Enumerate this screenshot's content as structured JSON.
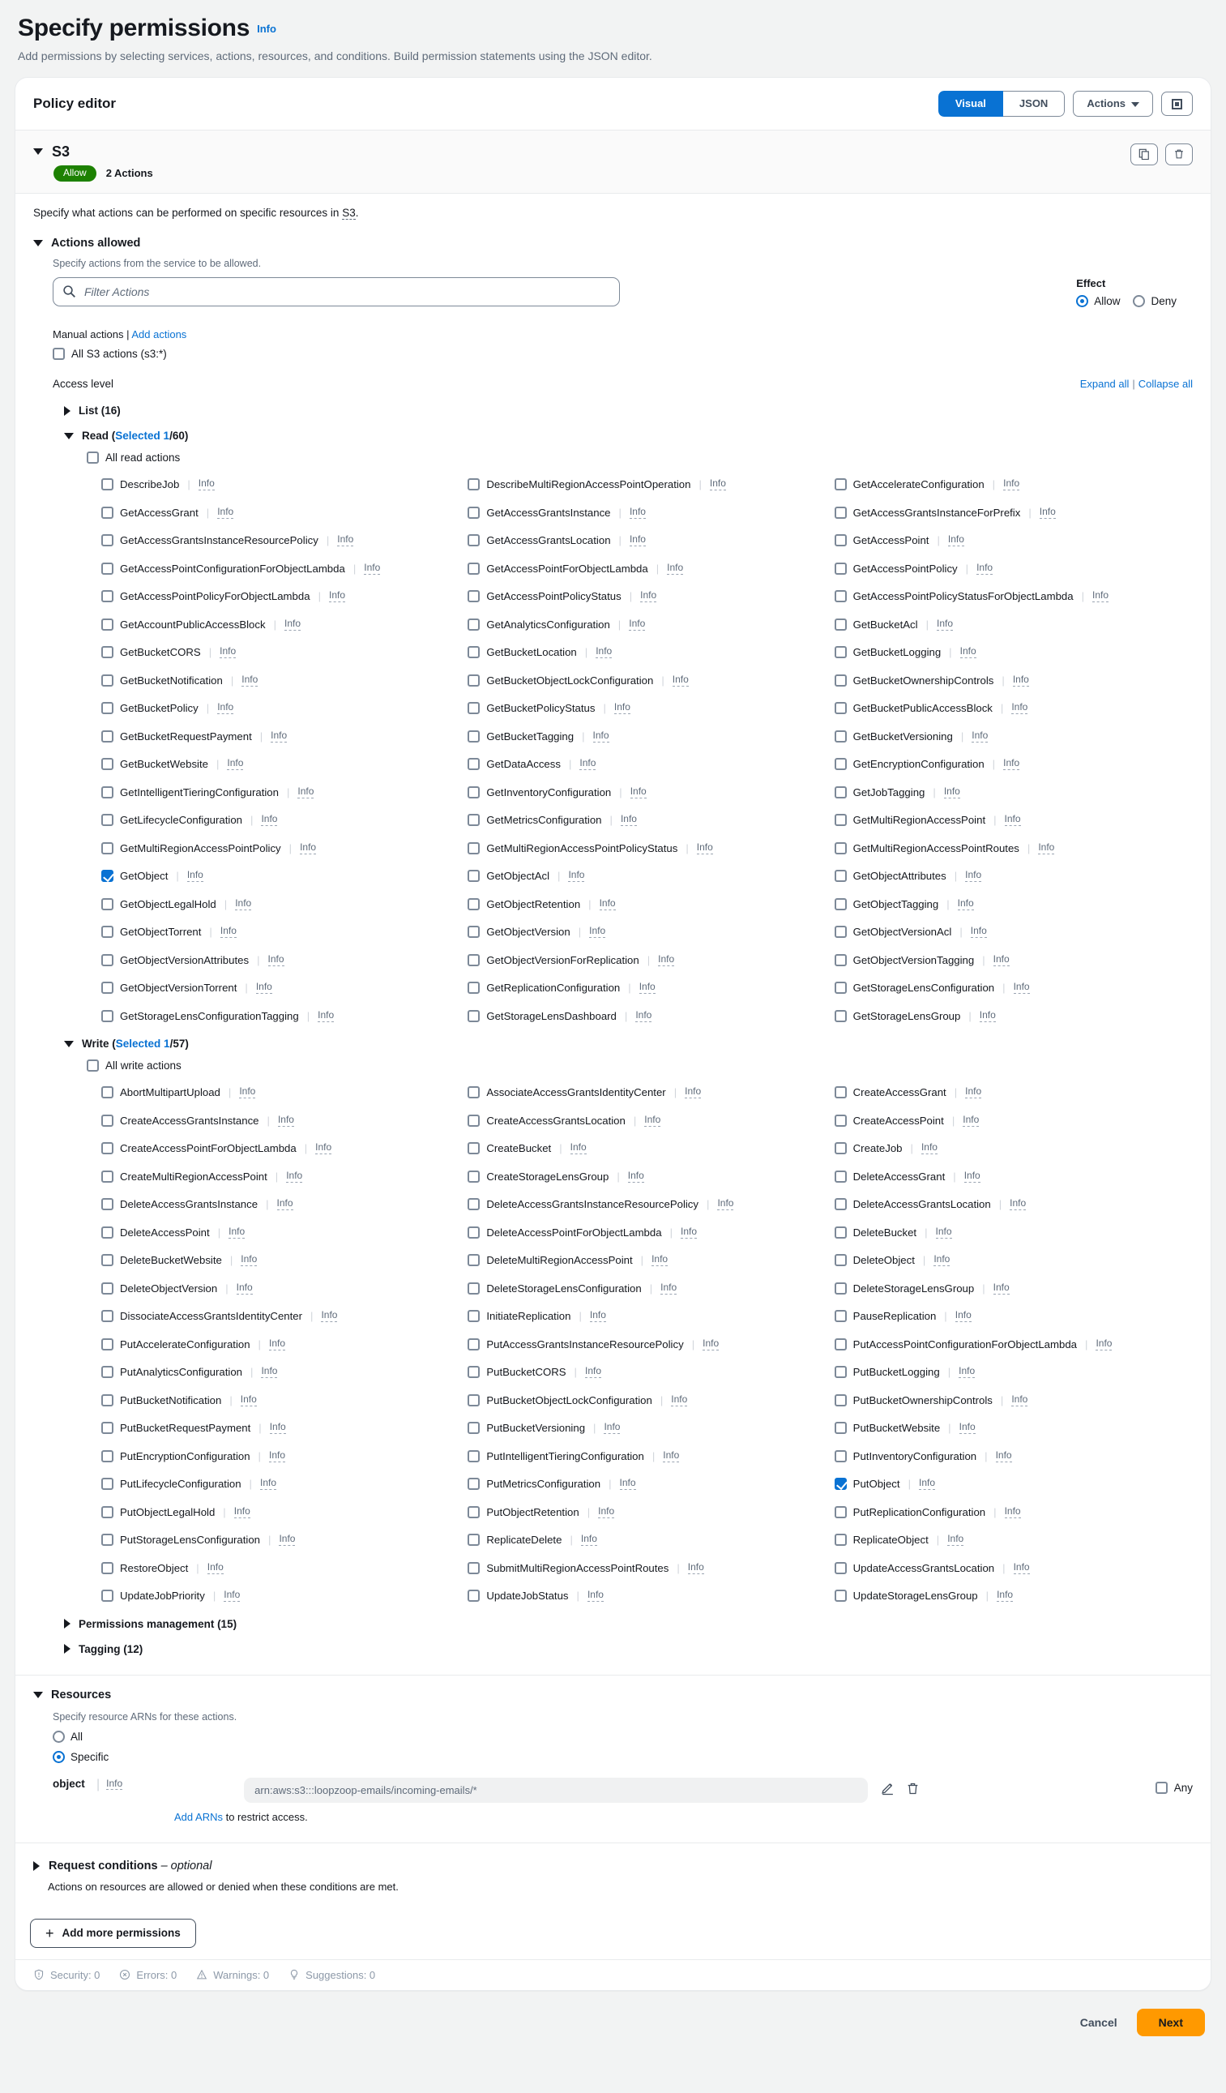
{
  "header": {
    "title": "Specify permissions",
    "info_label": "Info",
    "subtitle": "Add permissions by selecting services, actions, resources, and conditions. Build permission statements using the JSON editor."
  },
  "policy_editor": {
    "title": "Policy editor",
    "view_modes": [
      {
        "label": "Visual",
        "active": true
      },
      {
        "label": "JSON",
        "active": false
      }
    ],
    "actions_button": "Actions",
    "expand_icon": "expand-window-icon"
  },
  "statement": {
    "service": "S3",
    "effect_badge": "Allow",
    "actions_count": "2 Actions",
    "description_prefix": "Specify what actions can be performed on specific resources in ",
    "description_service": "S3",
    "description_suffix": ".",
    "copy_icon": "copy-icon",
    "delete_icon": "trash-icon"
  },
  "actions_allowed": {
    "section_label": "Actions allowed",
    "hint": "Specify actions from the service to be allowed.",
    "filter_placeholder": "Filter Actions",
    "search_icon": "search-icon",
    "effect": {
      "label": "Effect",
      "options": [
        {
          "label": "Allow",
          "selected": true
        },
        {
          "label": "Deny",
          "selected": false
        }
      ]
    },
    "manual_actions_label": "Manual actions",
    "separator": "|",
    "add_actions_link": "Add actions",
    "all_service_actions": "All S3 actions (s3:*)",
    "all_service_actions_checked": false,
    "access_level_label": "Access level",
    "expand_all": "Expand all",
    "collapse_all": "Collapse all"
  },
  "access_levels": [
    {
      "name": "List",
      "count_label": "List (16)",
      "expanded": false,
      "selected_prefix": "",
      "all_label": "",
      "actions": []
    },
    {
      "name": "Read",
      "label": "Read (",
      "selected_text": "Selected 1",
      "total_text": "/60)",
      "expanded": true,
      "all_label": "All read actions",
      "all_checked": false,
      "info_label": "Info",
      "actions": [
        {
          "name": "DescribeJob",
          "checked": false
        },
        {
          "name": "DescribeMultiRegionAccessPointOperation",
          "checked": false
        },
        {
          "name": "GetAccelerateConfiguration",
          "checked": false
        },
        {
          "name": "GetAccessGrant",
          "checked": false
        },
        {
          "name": "GetAccessGrantsInstance",
          "checked": false
        },
        {
          "name": "GetAccessGrantsInstanceForPrefix",
          "checked": false
        },
        {
          "name": "GetAccessGrantsInstanceResourcePolicy",
          "checked": false
        },
        {
          "name": "GetAccessGrantsLocation",
          "checked": false
        },
        {
          "name": "GetAccessPoint",
          "checked": false
        },
        {
          "name": "GetAccessPointConfigurationForObjectLambda",
          "checked": false
        },
        {
          "name": "GetAccessPointForObjectLambda",
          "checked": false
        },
        {
          "name": "GetAccessPointPolicy",
          "checked": false
        },
        {
          "name": "GetAccessPointPolicyForObjectLambda",
          "checked": false
        },
        {
          "name": "GetAccessPointPolicyStatus",
          "checked": false
        },
        {
          "name": "GetAccessPointPolicyStatusForObjectLambda",
          "checked": false
        },
        {
          "name": "GetAccountPublicAccessBlock",
          "checked": false
        },
        {
          "name": "GetAnalyticsConfiguration",
          "checked": false
        },
        {
          "name": "GetBucketAcl",
          "checked": false
        },
        {
          "name": "GetBucketCORS",
          "checked": false
        },
        {
          "name": "GetBucketLocation",
          "checked": false
        },
        {
          "name": "GetBucketLogging",
          "checked": false
        },
        {
          "name": "GetBucketNotification",
          "checked": false
        },
        {
          "name": "GetBucketObjectLockConfiguration",
          "checked": false
        },
        {
          "name": "GetBucketOwnershipControls",
          "checked": false
        },
        {
          "name": "GetBucketPolicy",
          "checked": false
        },
        {
          "name": "GetBucketPolicyStatus",
          "checked": false
        },
        {
          "name": "GetBucketPublicAccessBlock",
          "checked": false
        },
        {
          "name": "GetBucketRequestPayment",
          "checked": false
        },
        {
          "name": "GetBucketTagging",
          "checked": false
        },
        {
          "name": "GetBucketVersioning",
          "checked": false
        },
        {
          "name": "GetBucketWebsite",
          "checked": false
        },
        {
          "name": "GetDataAccess",
          "checked": false
        },
        {
          "name": "GetEncryptionConfiguration",
          "checked": false
        },
        {
          "name": "GetIntelligentTieringConfiguration",
          "checked": false
        },
        {
          "name": "GetInventoryConfiguration",
          "checked": false
        },
        {
          "name": "GetJobTagging",
          "checked": false
        },
        {
          "name": "GetLifecycleConfiguration",
          "checked": false
        },
        {
          "name": "GetMetricsConfiguration",
          "checked": false
        },
        {
          "name": "GetMultiRegionAccessPoint",
          "checked": false
        },
        {
          "name": "GetMultiRegionAccessPointPolicy",
          "checked": false
        },
        {
          "name": "GetMultiRegionAccessPointPolicyStatus",
          "checked": false
        },
        {
          "name": "GetMultiRegionAccessPointRoutes",
          "checked": false
        },
        {
          "name": "GetObject",
          "checked": true
        },
        {
          "name": "GetObjectAcl",
          "checked": false
        },
        {
          "name": "GetObjectAttributes",
          "checked": false
        },
        {
          "name": "GetObjectLegalHold",
          "checked": false
        },
        {
          "name": "GetObjectRetention",
          "checked": false
        },
        {
          "name": "GetObjectTagging",
          "checked": false
        },
        {
          "name": "GetObjectTorrent",
          "checked": false
        },
        {
          "name": "GetObjectVersion",
          "checked": false
        },
        {
          "name": "GetObjectVersionAcl",
          "checked": false
        },
        {
          "name": "GetObjectVersionAttributes",
          "checked": false
        },
        {
          "name": "GetObjectVersionForReplication",
          "checked": false
        },
        {
          "name": "GetObjectVersionTagging",
          "checked": false
        },
        {
          "name": "GetObjectVersionTorrent",
          "checked": false
        },
        {
          "name": "GetReplicationConfiguration",
          "checked": false
        },
        {
          "name": "GetStorageLensConfiguration",
          "checked": false
        },
        {
          "name": "GetStorageLensConfigurationTagging",
          "checked": false
        },
        {
          "name": "GetStorageLensDashboard",
          "checked": false
        },
        {
          "name": "GetStorageLensGroup",
          "checked": false
        }
      ]
    },
    {
      "name": "Write",
      "label": "Write (",
      "selected_text": "Selected 1",
      "total_text": "/57)",
      "expanded": true,
      "all_label": "All write actions",
      "all_checked": false,
      "info_label": "Info",
      "actions": [
        {
          "name": "AbortMultipartUpload",
          "checked": false
        },
        {
          "name": "AssociateAccessGrantsIdentityCenter",
          "checked": false
        },
        {
          "name": "CreateAccessGrant",
          "checked": false
        },
        {
          "name": "CreateAccessGrantsInstance",
          "checked": false
        },
        {
          "name": "CreateAccessGrantsLocation",
          "checked": false
        },
        {
          "name": "CreateAccessPoint",
          "checked": false
        },
        {
          "name": "CreateAccessPointForObjectLambda",
          "checked": false
        },
        {
          "name": "CreateBucket",
          "checked": false
        },
        {
          "name": "CreateJob",
          "checked": false
        },
        {
          "name": "CreateMultiRegionAccessPoint",
          "checked": false
        },
        {
          "name": "CreateStorageLensGroup",
          "checked": false
        },
        {
          "name": "DeleteAccessGrant",
          "checked": false
        },
        {
          "name": "DeleteAccessGrantsInstance",
          "checked": false
        },
        {
          "name": "DeleteAccessGrantsInstanceResourcePolicy",
          "checked": false
        },
        {
          "name": "DeleteAccessGrantsLocation",
          "checked": false
        },
        {
          "name": "DeleteAccessPoint",
          "checked": false
        },
        {
          "name": "DeleteAccessPointForObjectLambda",
          "checked": false
        },
        {
          "name": "DeleteBucket",
          "checked": false
        },
        {
          "name": "DeleteBucketWebsite",
          "checked": false
        },
        {
          "name": "DeleteMultiRegionAccessPoint",
          "checked": false
        },
        {
          "name": "DeleteObject",
          "checked": false
        },
        {
          "name": "DeleteObjectVersion",
          "checked": false
        },
        {
          "name": "DeleteStorageLensConfiguration",
          "checked": false
        },
        {
          "name": "DeleteStorageLensGroup",
          "checked": false
        },
        {
          "name": "DissociateAccessGrantsIdentityCenter",
          "checked": false
        },
        {
          "name": "InitiateReplication",
          "checked": false
        },
        {
          "name": "PauseReplication",
          "checked": false
        },
        {
          "name": "PutAccelerateConfiguration",
          "checked": false
        },
        {
          "name": "PutAccessGrantsInstanceResourcePolicy",
          "checked": false
        },
        {
          "name": "PutAccessPointConfigurationForObjectLambda",
          "checked": false
        },
        {
          "name": "PutAnalyticsConfiguration",
          "checked": false
        },
        {
          "name": "PutBucketCORS",
          "checked": false
        },
        {
          "name": "PutBucketLogging",
          "checked": false
        },
        {
          "name": "PutBucketNotification",
          "checked": false
        },
        {
          "name": "PutBucketObjectLockConfiguration",
          "checked": false
        },
        {
          "name": "PutBucketOwnershipControls",
          "checked": false
        },
        {
          "name": "PutBucketRequestPayment",
          "checked": false
        },
        {
          "name": "PutBucketVersioning",
          "checked": false
        },
        {
          "name": "PutBucketWebsite",
          "checked": false
        },
        {
          "name": "PutEncryptionConfiguration",
          "checked": false
        },
        {
          "name": "PutIntelligentTieringConfiguration",
          "checked": false
        },
        {
          "name": "PutInventoryConfiguration",
          "checked": false
        },
        {
          "name": "PutLifecycleConfiguration",
          "checked": false
        },
        {
          "name": "PutMetricsConfiguration",
          "checked": false
        },
        {
          "name": "PutObject",
          "checked": true
        },
        {
          "name": "PutObjectLegalHold",
          "checked": false
        },
        {
          "name": "PutObjectRetention",
          "checked": false
        },
        {
          "name": "PutReplicationConfiguration",
          "checked": false
        },
        {
          "name": "PutStorageLensConfiguration",
          "checked": false
        },
        {
          "name": "ReplicateDelete",
          "checked": false
        },
        {
          "name": "ReplicateObject",
          "checked": false
        },
        {
          "name": "RestoreObject",
          "checked": false
        },
        {
          "name": "SubmitMultiRegionAccessPointRoutes",
          "checked": false
        },
        {
          "name": "UpdateAccessGrantsLocation",
          "checked": false
        },
        {
          "name": "UpdateJobPriority",
          "checked": false
        },
        {
          "name": "UpdateJobStatus",
          "checked": false
        },
        {
          "name": "UpdateStorageLensGroup",
          "checked": false
        }
      ]
    },
    {
      "name": "Permissions management",
      "count_label": "Permissions management (15)",
      "expanded": false,
      "actions": []
    },
    {
      "name": "Tagging",
      "count_label": "Tagging (12)",
      "expanded": false,
      "actions": []
    }
  ],
  "resources": {
    "section_label": "Resources",
    "hint": "Specify resource ARNs for these actions.",
    "scope_options": [
      {
        "label": "All",
        "selected": false
      },
      {
        "label": "Specific",
        "selected": true
      }
    ],
    "resource_name": "object",
    "info_label": "Info",
    "arn_value": "arn:aws:s3:::loopzoop-emails/incoming-emails/*",
    "edit_icon": "pencil-icon",
    "delete_icon": "trash-icon",
    "add_arns_link": "Add ARNs",
    "add_arns_suffix": " to restrict access.",
    "any_label": "Any",
    "any_checked": false
  },
  "request_conditions": {
    "title": "Request conditions",
    "optional": " – optional",
    "description": "Actions on resources are allowed or denied when these conditions are met."
  },
  "footer": {
    "add_more_permissions": "Add more permissions",
    "status": [
      {
        "icon": "security-shield-icon",
        "label": "Security: 0"
      },
      {
        "icon": "error-circle-icon",
        "label": "Errors: 0"
      },
      {
        "icon": "warning-triangle-icon",
        "label": "Warnings: 0"
      },
      {
        "icon": "lightbulb-icon",
        "label": "Suggestions: 0"
      }
    ],
    "cancel": "Cancel",
    "next": "Next"
  },
  "colors": {
    "accent_blue": "#0972d3",
    "allow_green": "#1d8102",
    "next_orange": "#ff9900",
    "text": "#16191f",
    "muted": "#5f6b7a"
  }
}
